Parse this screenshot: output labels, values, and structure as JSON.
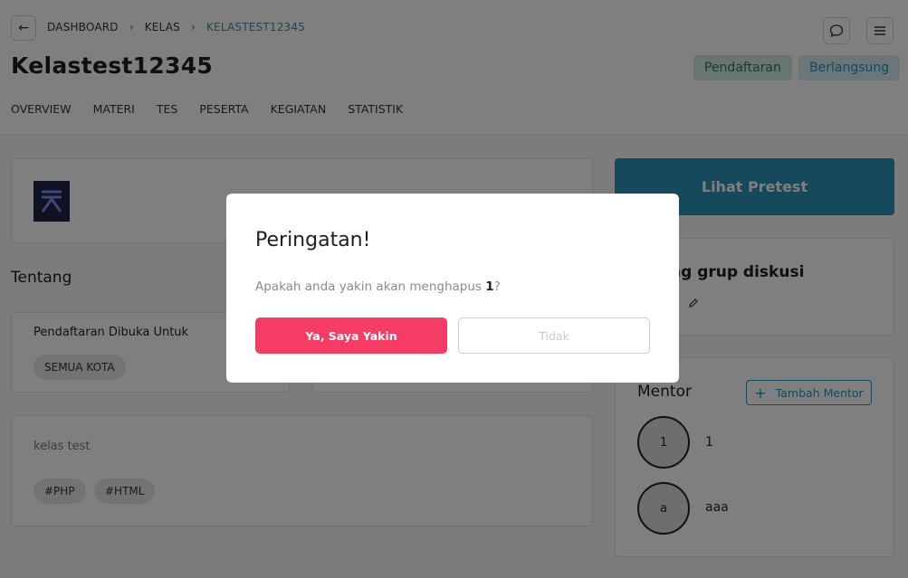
{
  "header": {
    "breadcrumb": [
      "DASHBOARD",
      "KELAS",
      "KELASTEST12345"
    ],
    "title": "Kelastest12345",
    "badges": [
      "Pendaftaran",
      "Berlangsung"
    ]
  },
  "tabs": [
    "OVERVIEW",
    "MATERI",
    "TES",
    "PESERTA",
    "KEGIATAN",
    "STATISTIK"
  ],
  "about": {
    "title": "Tentang",
    "registration_label": "Pendaftaran Dibuka Untuk",
    "registration_chip": "SEMUA KOTA",
    "description": "kelas test",
    "tags": [
      "#PHP",
      "#HTML"
    ]
  },
  "sidebar": {
    "pretest_button": "Lihat Pretest",
    "discussion_title_partial": "ng grup diskusi",
    "mentor_title": "Mentor",
    "add_mentor_button": "Tambah Mentor",
    "mentors": [
      {
        "initial": "1",
        "name": "1"
      },
      {
        "initial": "a",
        "name": "aaa"
      }
    ]
  },
  "modal": {
    "title": "Peringatan!",
    "message_prefix": "Apakah anda yakin akan menghapus ",
    "message_bold": "1",
    "message_suffix": "?",
    "confirm_button": "Ya, Saya Yakin",
    "cancel_button": "Tidak"
  },
  "colors": {
    "accent": "#2a93b6",
    "danger": "#f43c64",
    "badge_green_bg": "#cfeede",
    "badge_blue_bg": "#d6ecf5"
  },
  "icons": [
    "arrow-left-icon",
    "chevron-right-icon",
    "chat-icon",
    "menu-icon",
    "pencil-icon",
    "plus-icon"
  ]
}
